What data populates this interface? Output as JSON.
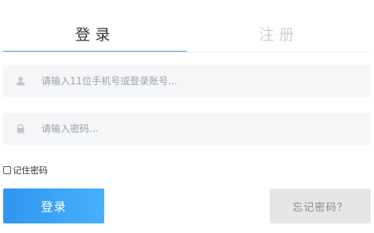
{
  "tabs": {
    "login_label": "登录",
    "register_label": "注册"
  },
  "account_field": {
    "placeholder": "请输入11位手机号或登录账号...",
    "value": "",
    "icon": "user-icon"
  },
  "password_field": {
    "placeholder": "请输入密码...",
    "value": "",
    "icon": "lock-icon"
  },
  "remember": {
    "label": "记住密码",
    "checked": false
  },
  "buttons": {
    "login_label": "登录",
    "forgot_label": "忘记密码？"
  },
  "colors": {
    "active_tab_underline": "#4a9ab6",
    "inactive_tab_text": "#c9d2dc",
    "login_button": "#2f96f0",
    "forgot_button": "#e6e6e6",
    "input_background": "#f5f6f8"
  }
}
